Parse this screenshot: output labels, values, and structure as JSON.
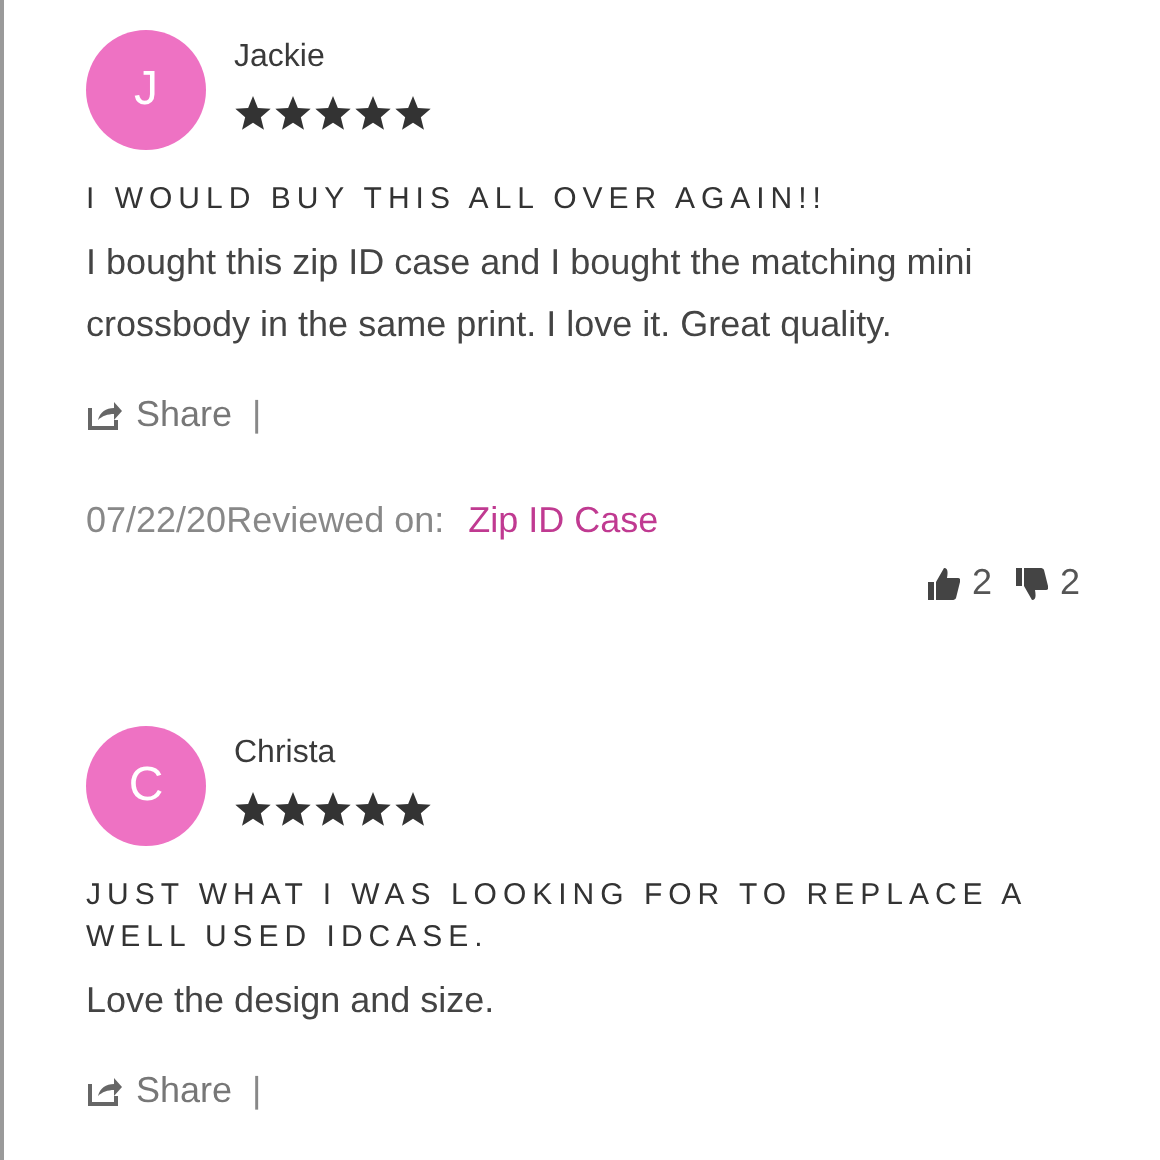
{
  "reviews": [
    {
      "initial": "J",
      "name": "Jackie",
      "stars": 5,
      "title": "I WOULD BUY THIS ALL OVER AGAIN!!",
      "body": "I bought this zip ID case and I bought the matching mini crossbody in the same print. I love it. Great quality.",
      "share": "Share",
      "separator": "|",
      "date": "07/22/20",
      "reviewed_label": "Reviewed on:",
      "product": "Zip ID Case",
      "helpful": "2",
      "unhelpful": "2"
    },
    {
      "initial": "C",
      "name": "Christa",
      "stars": 5,
      "title": "JUST WHAT I WAS LOOKING FOR TO REPLACE A WELL USED IDCASE.",
      "body": "Love the design and size.",
      "share": "Share",
      "separator": "|"
    }
  ]
}
